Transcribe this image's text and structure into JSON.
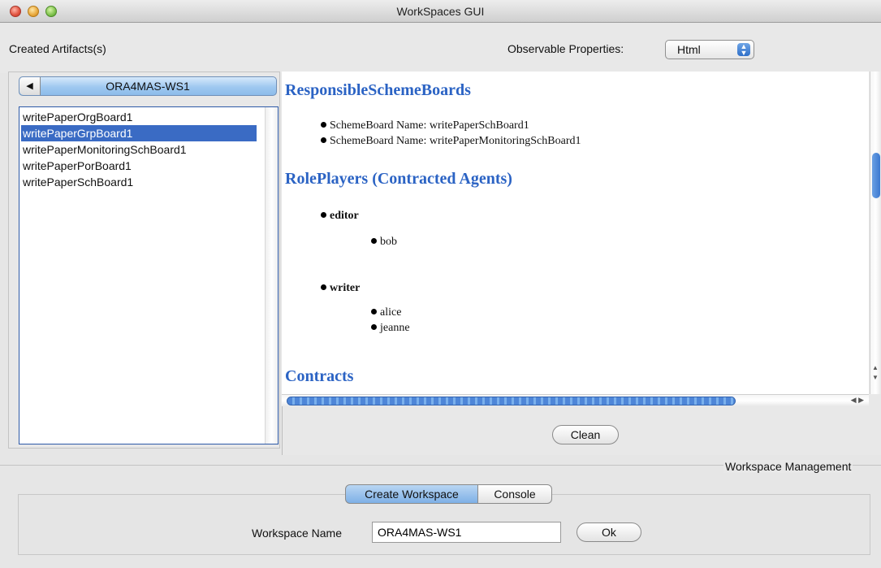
{
  "window": {
    "title": "WorkSpaces GUI"
  },
  "toolbar": {
    "created_label": "Created Artifacts(s)",
    "observable_label": "Observable Properties:",
    "observable_value": "Html"
  },
  "workspace_tab": {
    "label": "ORA4MAS-WS1"
  },
  "artifacts": [
    {
      "label": "writePaperOrgBoard1"
    },
    {
      "label": "writePaperGrpBoard1"
    },
    {
      "label": "writePaperMonitoringSchBoard1"
    },
    {
      "label": "writePaperPorBoard1"
    },
    {
      "label": "writePaperSchBoard1"
    }
  ],
  "selected_artifact_index": 1,
  "html_view": {
    "section1": "ResponsibleSchemeBoards",
    "scheme_boards": [
      "SchemeBoard Name: writePaperSchBoard1",
      "SchemeBoard Name: writePaperMonitoringSchBoard1"
    ],
    "section2": "RolePlayers (Contracted Agents)",
    "roles": [
      {
        "role": "editor",
        "agents": [
          "bob"
        ]
      },
      {
        "role": "writer",
        "agents": [
          "alice",
          "jeanne"
        ]
      }
    ],
    "section3": "Contracts"
  },
  "clean_button": "Clean",
  "workspace_management": {
    "label": "Workspace Management",
    "tabs": [
      "Create Workspace",
      "Console"
    ],
    "name_label": "Workspace Name",
    "name_value": "ORA4MAS-WS1",
    "ok_button": "Ok"
  },
  "colors": {
    "heading": "#2b63c4",
    "selection": "#3a6bc4"
  }
}
